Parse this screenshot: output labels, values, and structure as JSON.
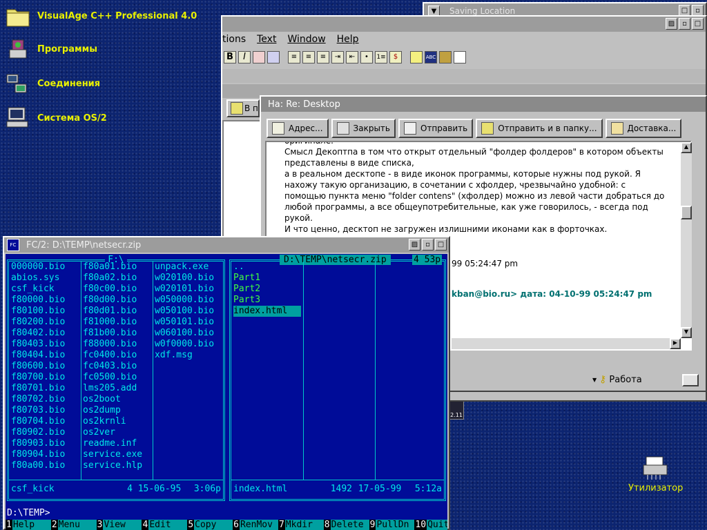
{
  "desktop": {
    "icons": [
      {
        "name": "visualage-folder-icon",
        "label": "VisualAge C++ Professional 4.0"
      },
      {
        "name": "programs-icon",
        "label": "Программы"
      },
      {
        "name": "connections-icon",
        "label": "Соединения"
      },
      {
        "name": "os2-system-icon",
        "label": "Система OS/2"
      }
    ],
    "shredder_label": "Утилизатор"
  },
  "saving_window": {
    "title": "Saving Location"
  },
  "editor": {
    "menu": [
      "tions",
      "Text",
      "Window",
      "Help"
    ],
    "tab_label": "В п"
  },
  "mail": {
    "title": "На: Re: Desktop",
    "buttons": [
      "Адрес...",
      "Закрыть",
      "Отправить",
      "Отправить и в папку...",
      "Доставка..."
    ],
    "body_lines": [
      "оригинале.",
      "Смысл Декоптпа в том что открыт отдельный \"фолдер фолдеров\" в котором объекты",
      "представлены в виде списка,",
      "а в реальном десктопе - в виде иконок программы, которые нужны под рукой. Я",
      "нахожу такую организацию, в сочетании с хфолдер, чрезвычайно удобной: с",
      "помощью пункта меню \"folder contens\" (хфолдер) можно из левой части добраться до",
      "любой программы, а все общеупотребительные, как уже говорилось, - всегда под",
      "рукой.",
      "И что ценно, десктоп не загружен излишними иконами как в форточках."
    ],
    "partial_line1": "99 05:24:47 pm",
    "partial_line2": "kban@bio.ru> дата: 04-10-99 05:24:47 pm",
    "status": "Работа"
  },
  "fc": {
    "title": "FC/2: D:\\TEMP\\netsecr.zip",
    "left_header": "F:\\",
    "left_col1": [
      "000000.bio",
      "abios.sys",
      "csf_kick",
      "f80000.bio",
      "f80100.bio",
      "f80200.bio",
      "f80402.bio",
      "f80403.bio",
      "f80404.bio",
      "f80600.bio",
      "f80700.bio",
      "f80701.bio",
      "f80702.bio",
      "f80703.bio",
      "f80704.bio",
      "f80902.bio",
      "f80903.bio",
      "f80904.bio",
      "f80a00.bio"
    ],
    "left_col2": [
      "f80a01.bio",
      "f80a02.bio",
      "f80c00.bio",
      "f80d00.bio",
      "f80d01.bio",
      "f81000.bio",
      "f81b00.bio",
      "f88000.bio",
      "fc0400.bio",
      "fc0403.bio",
      "fc0500.bio",
      "lms205.add",
      "os2boot",
      "os2dump",
      "os2krnli",
      "os2ver",
      "readme.inf",
      "service.exe",
      "service.hlp"
    ],
    "left_col3": [
      "unpack.exe",
      "w020100.bio",
      "w020101.bio",
      "w050000.bio",
      "w050100.bio",
      "w050101.bio",
      "w060100.bio",
      "w0f0000.bio",
      "xdf.msg"
    ],
    "left_status": {
      "name": "csf_kick",
      "size": "4",
      "date": "15-06-95",
      "time": "3:06p"
    },
    "right_header": "D:\\TEMP\\netsecr.zip",
    "right_badge": "4 53p",
    "right_items": [
      "..",
      "Part1",
      "Part2",
      "Part3",
      "index.html"
    ],
    "right_status": {
      "name": "index.html",
      "size": "1492",
      "date": "17-05-99",
      "time": "5:12a"
    },
    "prompt": "D:\\TEMP>",
    "fkeys": [
      {
        "n": "1",
        "l": "Help"
      },
      {
        "n": "2",
        "l": "Menu"
      },
      {
        "n": "3",
        "l": "View"
      },
      {
        "n": "4",
        "l": "Edit"
      },
      {
        "n": "5",
        "l": "Copy"
      },
      {
        "n": "6",
        "l": "RenMov"
      },
      {
        "n": "7",
        "l": "Mkdir"
      },
      {
        "n": "8",
        "l": "Delete"
      },
      {
        "n": "9",
        "l": "PullDn"
      },
      {
        "n": "10",
        "l": "Quit"
      }
    ]
  }
}
